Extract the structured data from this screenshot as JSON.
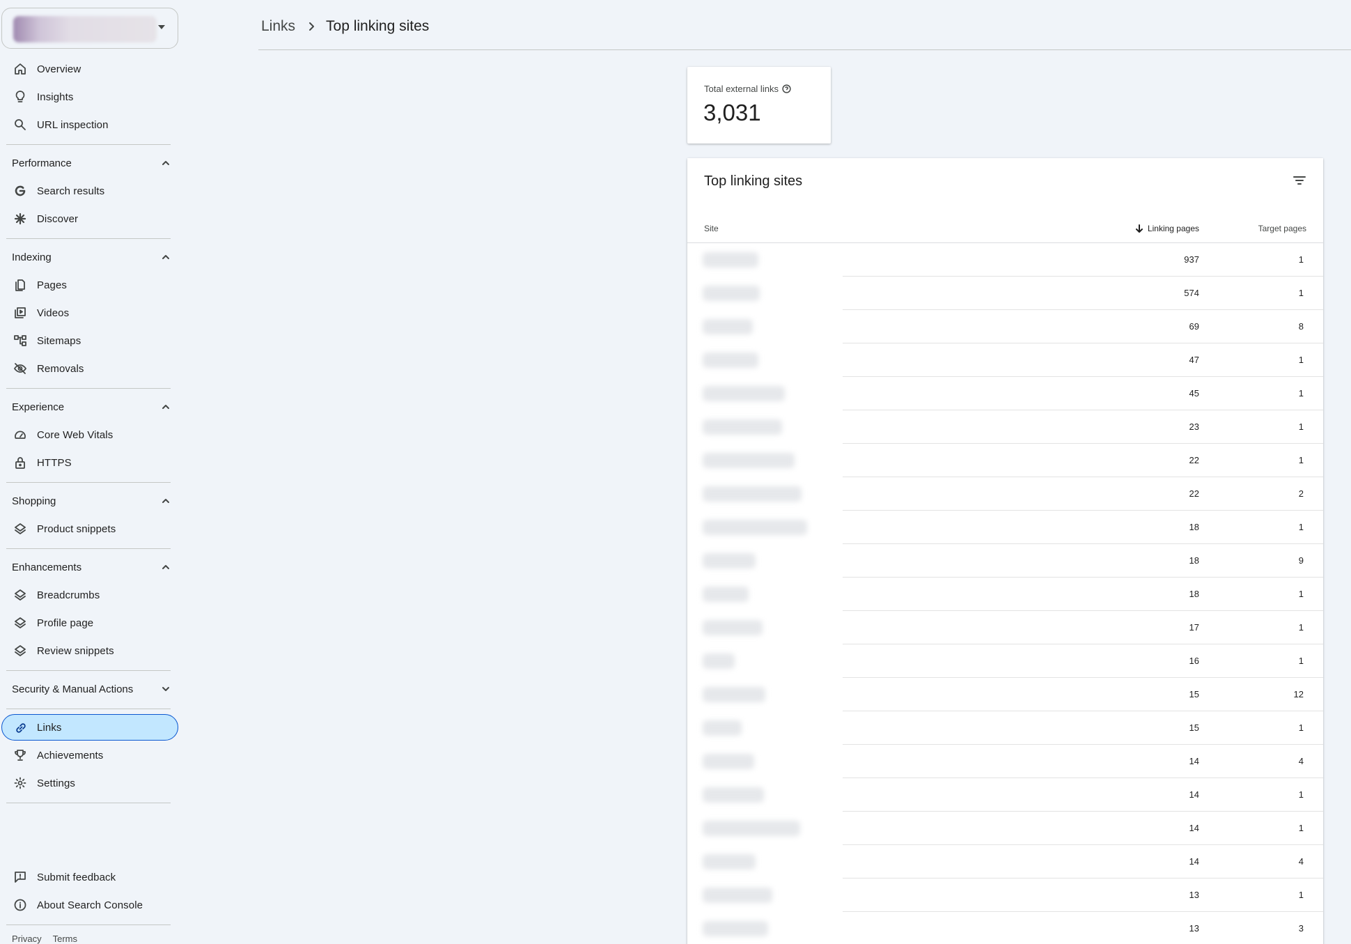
{
  "sidebar": {
    "top_items": [
      {
        "label": "Overview",
        "icon": "home-icon"
      },
      {
        "label": "Insights",
        "icon": "lightbulb-icon"
      },
      {
        "label": "URL inspection",
        "icon": "search-icon"
      }
    ],
    "sections": [
      {
        "title": "Performance",
        "items": [
          {
            "label": "Search results"
          },
          {
            "label": "Discover"
          }
        ]
      },
      {
        "title": "Indexing",
        "items": [
          {
            "label": "Pages"
          },
          {
            "label": "Videos"
          },
          {
            "label": "Sitemaps"
          },
          {
            "label": "Removals"
          }
        ]
      },
      {
        "title": "Experience",
        "items": [
          {
            "label": "Core Web Vitals"
          },
          {
            "label": "HTTPS"
          }
        ]
      },
      {
        "title": "Shopping",
        "items": [
          {
            "label": "Product snippets"
          }
        ]
      },
      {
        "title": "Enhancements",
        "items": [
          {
            "label": "Breadcrumbs"
          },
          {
            "label": "Profile page"
          },
          {
            "label": "Review snippets"
          }
        ]
      },
      {
        "title": "Security & Manual Actions",
        "items": []
      }
    ],
    "bottom_items": [
      {
        "label": "Links",
        "active": true
      },
      {
        "label": "Achievements"
      },
      {
        "label": "Settings"
      }
    ],
    "footer_items": [
      {
        "label": "Submit feedback"
      },
      {
        "label": "About Search Console"
      }
    ],
    "footer_links": [
      "Privacy",
      "Terms"
    ]
  },
  "header": {
    "breadcrumb_parent": "Links",
    "breadcrumb_current": "Top linking sites"
  },
  "summary": {
    "label": "Total external links",
    "value": "3,031"
  },
  "table": {
    "title": "Top linking sites",
    "columns": {
      "site": "Site",
      "linking_pages": "Linking pages",
      "target_pages": "Target pages"
    },
    "rows": [
      {
        "linking": "937",
        "target": "1"
      },
      {
        "linking": "574",
        "target": "1"
      },
      {
        "linking": "69",
        "target": "8"
      },
      {
        "linking": "47",
        "target": "1"
      },
      {
        "linking": "45",
        "target": "1"
      },
      {
        "linking": "23",
        "target": "1"
      },
      {
        "linking": "22",
        "target": "1"
      },
      {
        "linking": "22",
        "target": "2"
      },
      {
        "linking": "18",
        "target": "1"
      },
      {
        "linking": "18",
        "target": "9"
      },
      {
        "linking": "18",
        "target": "1"
      },
      {
        "linking": "17",
        "target": "1"
      },
      {
        "linking": "16",
        "target": "1"
      },
      {
        "linking": "15",
        "target": "12"
      },
      {
        "linking": "15",
        "target": "1"
      },
      {
        "linking": "14",
        "target": "4"
      },
      {
        "linking": "14",
        "target": "1"
      },
      {
        "linking": "14",
        "target": "1"
      },
      {
        "linking": "14",
        "target": "4"
      },
      {
        "linking": "13",
        "target": "1"
      },
      {
        "linking": "13",
        "target": "3"
      }
    ]
  }
}
